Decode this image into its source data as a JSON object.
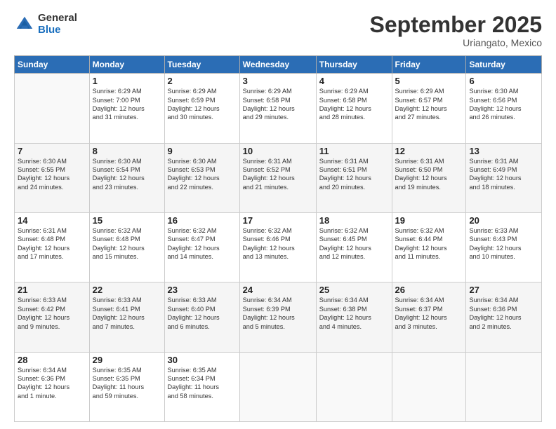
{
  "logo": {
    "general": "General",
    "blue": "Blue"
  },
  "header": {
    "month": "September 2025",
    "location": "Uriangato, Mexico"
  },
  "days_header": [
    "Sunday",
    "Monday",
    "Tuesday",
    "Wednesday",
    "Thursday",
    "Friday",
    "Saturday"
  ],
  "weeks": [
    [
      {
        "num": "",
        "info": ""
      },
      {
        "num": "1",
        "info": "Sunrise: 6:29 AM\nSunset: 7:00 PM\nDaylight: 12 hours\nand 31 minutes."
      },
      {
        "num": "2",
        "info": "Sunrise: 6:29 AM\nSunset: 6:59 PM\nDaylight: 12 hours\nand 30 minutes."
      },
      {
        "num": "3",
        "info": "Sunrise: 6:29 AM\nSunset: 6:58 PM\nDaylight: 12 hours\nand 29 minutes."
      },
      {
        "num": "4",
        "info": "Sunrise: 6:29 AM\nSunset: 6:58 PM\nDaylight: 12 hours\nand 28 minutes."
      },
      {
        "num": "5",
        "info": "Sunrise: 6:29 AM\nSunset: 6:57 PM\nDaylight: 12 hours\nand 27 minutes."
      },
      {
        "num": "6",
        "info": "Sunrise: 6:30 AM\nSunset: 6:56 PM\nDaylight: 12 hours\nand 26 minutes."
      }
    ],
    [
      {
        "num": "7",
        "info": "Sunrise: 6:30 AM\nSunset: 6:55 PM\nDaylight: 12 hours\nand 24 minutes."
      },
      {
        "num": "8",
        "info": "Sunrise: 6:30 AM\nSunset: 6:54 PM\nDaylight: 12 hours\nand 23 minutes."
      },
      {
        "num": "9",
        "info": "Sunrise: 6:30 AM\nSunset: 6:53 PM\nDaylight: 12 hours\nand 22 minutes."
      },
      {
        "num": "10",
        "info": "Sunrise: 6:31 AM\nSunset: 6:52 PM\nDaylight: 12 hours\nand 21 minutes."
      },
      {
        "num": "11",
        "info": "Sunrise: 6:31 AM\nSunset: 6:51 PM\nDaylight: 12 hours\nand 20 minutes."
      },
      {
        "num": "12",
        "info": "Sunrise: 6:31 AM\nSunset: 6:50 PM\nDaylight: 12 hours\nand 19 minutes."
      },
      {
        "num": "13",
        "info": "Sunrise: 6:31 AM\nSunset: 6:49 PM\nDaylight: 12 hours\nand 18 minutes."
      }
    ],
    [
      {
        "num": "14",
        "info": "Sunrise: 6:31 AM\nSunset: 6:48 PM\nDaylight: 12 hours\nand 17 minutes."
      },
      {
        "num": "15",
        "info": "Sunrise: 6:32 AM\nSunset: 6:48 PM\nDaylight: 12 hours\nand 15 minutes."
      },
      {
        "num": "16",
        "info": "Sunrise: 6:32 AM\nSunset: 6:47 PM\nDaylight: 12 hours\nand 14 minutes."
      },
      {
        "num": "17",
        "info": "Sunrise: 6:32 AM\nSunset: 6:46 PM\nDaylight: 12 hours\nand 13 minutes."
      },
      {
        "num": "18",
        "info": "Sunrise: 6:32 AM\nSunset: 6:45 PM\nDaylight: 12 hours\nand 12 minutes."
      },
      {
        "num": "19",
        "info": "Sunrise: 6:32 AM\nSunset: 6:44 PM\nDaylight: 12 hours\nand 11 minutes."
      },
      {
        "num": "20",
        "info": "Sunrise: 6:33 AM\nSunset: 6:43 PM\nDaylight: 12 hours\nand 10 minutes."
      }
    ],
    [
      {
        "num": "21",
        "info": "Sunrise: 6:33 AM\nSunset: 6:42 PM\nDaylight: 12 hours\nand 9 minutes."
      },
      {
        "num": "22",
        "info": "Sunrise: 6:33 AM\nSunset: 6:41 PM\nDaylight: 12 hours\nand 7 minutes."
      },
      {
        "num": "23",
        "info": "Sunrise: 6:33 AM\nSunset: 6:40 PM\nDaylight: 12 hours\nand 6 minutes."
      },
      {
        "num": "24",
        "info": "Sunrise: 6:34 AM\nSunset: 6:39 PM\nDaylight: 12 hours\nand 5 minutes."
      },
      {
        "num": "25",
        "info": "Sunrise: 6:34 AM\nSunset: 6:38 PM\nDaylight: 12 hours\nand 4 minutes."
      },
      {
        "num": "26",
        "info": "Sunrise: 6:34 AM\nSunset: 6:37 PM\nDaylight: 12 hours\nand 3 minutes."
      },
      {
        "num": "27",
        "info": "Sunrise: 6:34 AM\nSunset: 6:36 PM\nDaylight: 12 hours\nand 2 minutes."
      }
    ],
    [
      {
        "num": "28",
        "info": "Sunrise: 6:34 AM\nSunset: 6:36 PM\nDaylight: 12 hours\nand 1 minute."
      },
      {
        "num": "29",
        "info": "Sunrise: 6:35 AM\nSunset: 6:35 PM\nDaylight: 11 hours\nand 59 minutes."
      },
      {
        "num": "30",
        "info": "Sunrise: 6:35 AM\nSunset: 6:34 PM\nDaylight: 11 hours\nand 58 minutes."
      },
      {
        "num": "",
        "info": ""
      },
      {
        "num": "",
        "info": ""
      },
      {
        "num": "",
        "info": ""
      },
      {
        "num": "",
        "info": ""
      }
    ]
  ]
}
